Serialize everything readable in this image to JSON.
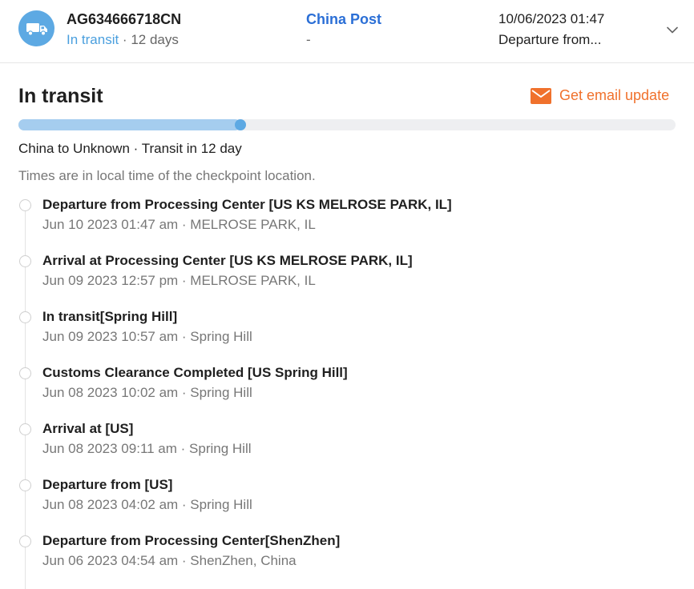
{
  "header": {
    "tracking_number": "AG634666718CN",
    "status": "In transit",
    "status_separator": " · ",
    "days": "12 days",
    "carrier": "China Post",
    "carrier_sub": "-",
    "latest_time": "10/06/2023 01:47",
    "latest_desc": "Departure from...",
    "icon": "truck-icon",
    "expand_icon": "chevron-down-icon"
  },
  "summary": {
    "title": "In transit",
    "email_label": "Get email update",
    "email_icon": "mail-icon",
    "progress": 0.338,
    "route": "China to Unknown · Transit in 12 day",
    "note": "Times are in local time of the checkpoint location."
  },
  "events": [
    {
      "title": "Departure from Processing Center [US KS MELROSE PARK, IL]",
      "meta": "Jun 10 2023 01:47 am · MELROSE PARK, IL"
    },
    {
      "title": "Arrival at Processing Center [US KS MELROSE PARK, IL]",
      "meta": "Jun 09 2023 12:57 pm · MELROSE PARK, IL"
    },
    {
      "title": "In transit[Spring Hill]",
      "meta": "Jun 09 2023 10:57 am · Spring Hill"
    },
    {
      "title": "Customs Clearance Completed [US Spring Hill]",
      "meta": "Jun 08 2023 10:02 am · Spring Hill"
    },
    {
      "title": "Arrival at [US]",
      "meta": "Jun 08 2023 09:11 am · Spring Hill"
    },
    {
      "title": "Departure from [US]",
      "meta": "Jun 08 2023 04:02 am · Spring Hill"
    },
    {
      "title": "Departure from Processing Center[ShenZhen]",
      "meta": "Jun 06 2023 04:54 am · ShenZhen, China"
    }
  ],
  "colors": {
    "accent_blue": "#5da9e3",
    "status_blue": "#4a9fde",
    "carrier_blue": "#2b6fd6",
    "email_orange": "#f0712c",
    "progress_light": "#a5cdef"
  }
}
